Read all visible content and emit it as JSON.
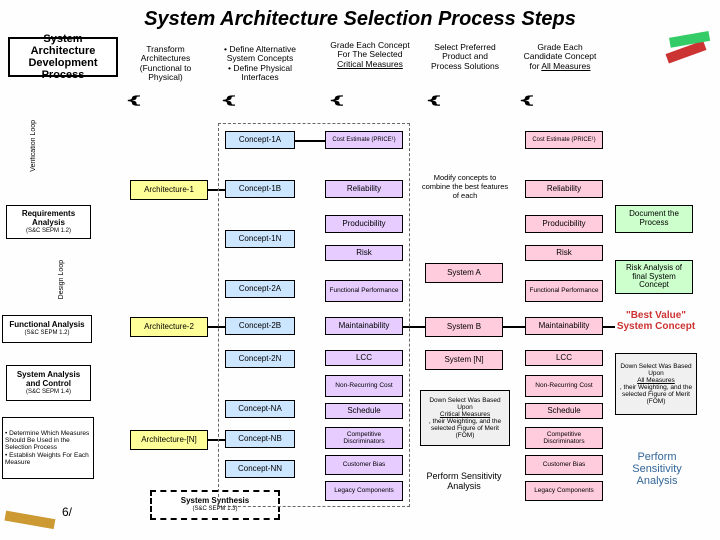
{
  "title": "System Architecture Selection Process Steps",
  "header": {
    "process": "System Architecture Development Process",
    "transform": "Transform Architectures (Functional to Physical)",
    "define": "• Define Alternative System Concepts\n• Define Physical Interfaces",
    "grade_crit": "Grade Each Concept For The Selected Critical Measures",
    "select": "Select Preferred Product and Process Solutions",
    "grade_all": "Grade Each Candidate Concept for All Measures"
  },
  "left": {
    "verif": "Verification Loop",
    "req": "Requirements Analysis",
    "req_sub": "(S&C SEPM 1.2)",
    "design": "Design Loop",
    "func": "Functional Analysis",
    "func_sub": "(S&C SEPM 1.2)",
    "control": "System Analysis and Control",
    "control_sub": "(S&C SEPM 1.4)",
    "determine": "• Determine Which Measures Should Be Used in the Selection Process\n• Establish Weights For Each Measure"
  },
  "arch": {
    "a1": "Architecture-1",
    "a2": "Architecture-2",
    "an": "Architecture-[N]"
  },
  "concepts": {
    "c1a": "Concept-1A",
    "c1b": "Concept-1B",
    "c1n": "Concept-1N",
    "c2a": "Concept-2A",
    "c2b": "Concept-2B",
    "c2n": "Concept-2N",
    "cna": "Concept-NA",
    "cnb": "Concept-NB",
    "cnn": "Concept-NN"
  },
  "measures": {
    "cost": "Cost Estimate (PRICE¹)",
    "reliability": "Reliability",
    "producibility": "Producibility",
    "risk": "Risk",
    "funcperf": "Functional Performance",
    "maintain": "Maintainability",
    "lcc": "LCC",
    "nonrec": "Non-Recurring Cost",
    "schedule": "Schedule",
    "compet": "Competitive Discriminators",
    "custbias": "Customer Bias",
    "legacy": "Legacy Components"
  },
  "systems": {
    "a": "System A",
    "b": "System B",
    "n": "System [N]"
  },
  "mid": {
    "modify": "Modify concepts to combine the best features of each",
    "downselect": "Down Select Was Based Upon Critical Measures, their Weighting, and the selected Figure of Merit (FOM)",
    "perform": "Perform Sensitivity Analysis"
  },
  "right": {
    "doc": "Document the Process",
    "risk": "Risk Analysis of final System Concept",
    "best": "\"Best Value\" System Concept",
    "down2": "Down Select Was Based Upon All Measures, their Weighting, and the selected Figure of Merit (FOM)",
    "perform2": "Perform Sensitivity Analysis"
  },
  "synth": {
    "title": "System Synthesis",
    "sub": "(S&C SEPM 1.3)"
  },
  "date": "6/"
}
